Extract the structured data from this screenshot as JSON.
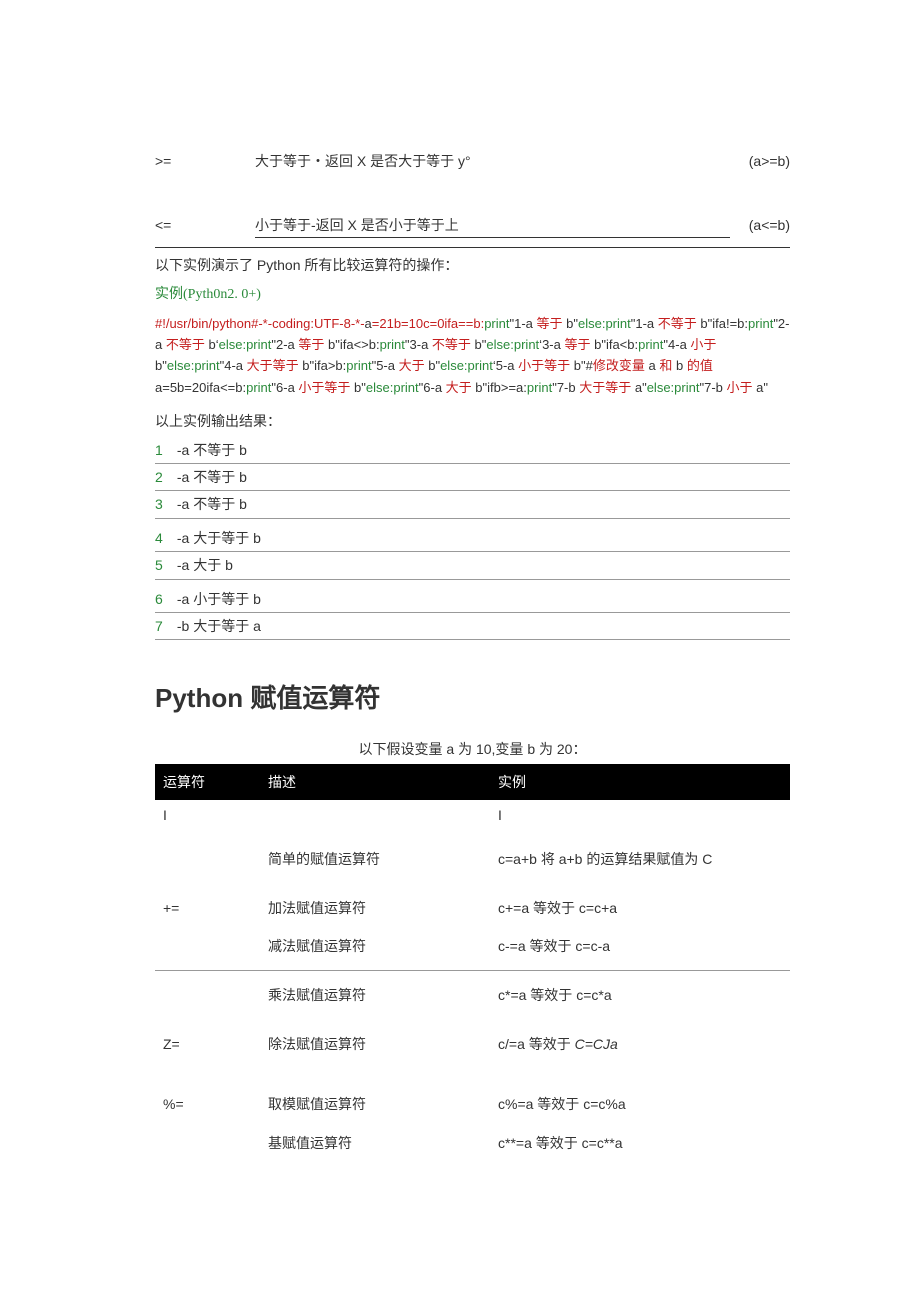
{
  "comparison_rows": [
    {
      "op": ">=",
      "desc": "大于等于・返回 X 是否大于等于 y°",
      "example": "(a>=b)",
      "underlined": false
    },
    {
      "op": "<=",
      "desc": "小于等于-返回 X 是否小于等于上",
      "example": "(a<=b)",
      "underlined": true
    }
  ],
  "intro": "以下实例演示了 Python 所有比较运算符的操作：",
  "example_title": "实例(Pyth0n2. 0+)",
  "code_segments": [
    {
      "t": "#!/usr/bin/python#-*-coding:UTF-8-*-",
      "c": "k-red"
    },
    {
      "t": "a",
      "c": ""
    },
    {
      "t": "=21b=10c=0ifa==b:",
      "c": "k-red"
    },
    {
      "t": "print",
      "c": "k-green"
    },
    {
      "t": "\"1-a ",
      "c": ""
    },
    {
      "t": "等于",
      "c": "k-red"
    },
    {
      "t": " b\"",
      "c": ""
    },
    {
      "t": "else:",
      "c": "k-green"
    },
    {
      "t": "print",
      "c": "k-green"
    },
    {
      "t": "\"1-a ",
      "c": ""
    },
    {
      "t": "不等于",
      "c": "k-red"
    },
    {
      "t": " b\"ifa!=b:",
      "c": ""
    },
    {
      "t": "print",
      "c": "k-green"
    },
    {
      "t": "\"2-a ",
      "c": ""
    },
    {
      "t": "不等于",
      "c": "k-red"
    },
    {
      "t": " b",
      "c": ""
    },
    {
      "t": "‘",
      "c": ""
    },
    {
      "t": "else:",
      "c": "k-green"
    },
    {
      "t": "print",
      "c": "k-green"
    },
    {
      "t": "\"2-a ",
      "c": ""
    },
    {
      "t": "等于",
      "c": "k-red"
    },
    {
      "t": " b\"ifa<>b:",
      "c": ""
    },
    {
      "t": "print",
      "c": "k-green"
    },
    {
      "t": "\"3-a ",
      "c": ""
    },
    {
      "t": "不等于",
      "c": "k-red"
    },
    {
      "t": " b\"",
      "c": ""
    },
    {
      "t": "else:",
      "c": "k-green"
    },
    {
      "t": "print",
      "c": "k-green"
    },
    {
      "t": "‘",
      "c": ""
    },
    {
      "t": "3-a ",
      "c": ""
    },
    {
      "t": "等于",
      "c": "k-red"
    },
    {
      "t": " b\"ifa<b:",
      "c": ""
    },
    {
      "t": "print",
      "c": "k-green"
    },
    {
      "t": "\"4-a ",
      "c": ""
    },
    {
      "t": "小于",
      "c": "k-red"
    },
    {
      "t": " b\"",
      "c": ""
    },
    {
      "t": "else:",
      "c": "k-green"
    },
    {
      "t": "print",
      "c": "k-green"
    },
    {
      "t": "\"4-a ",
      "c": ""
    },
    {
      "t": "大于等于",
      "c": "k-red"
    },
    {
      "t": " b\"ifa>b:",
      "c": ""
    },
    {
      "t": "print",
      "c": "k-green"
    },
    {
      "t": "\"5-a ",
      "c": ""
    },
    {
      "t": "大于",
      "c": "k-red"
    },
    {
      "t": " b\"",
      "c": ""
    },
    {
      "t": "else:",
      "c": "k-green"
    },
    {
      "t": "print",
      "c": "k-green"
    },
    {
      "t": "‘",
      "c": ""
    },
    {
      "t": "5-a ",
      "c": ""
    },
    {
      "t": "小于等于",
      "c": "k-red"
    },
    {
      "t": " b\"#",
      "c": ""
    },
    {
      "t": "修改变量",
      "c": "k-red"
    },
    {
      "t": " a ",
      "c": ""
    },
    {
      "t": "和",
      "c": "k-red"
    },
    {
      "t": " b ",
      "c": ""
    },
    {
      "t": "的值",
      "c": "k-red"
    },
    {
      "t": " a=5b=20ifa<=b:",
      "c": ""
    },
    {
      "t": "print",
      "c": "k-green"
    },
    {
      "t": "\"6-a ",
      "c": ""
    },
    {
      "t": "小于等于",
      "c": "k-red"
    },
    {
      "t": " b\"",
      "c": ""
    },
    {
      "t": "else:",
      "c": "k-green"
    },
    {
      "t": "print",
      "c": "k-green"
    },
    {
      "t": "\"6-a ",
      "c": ""
    },
    {
      "t": "大于",
      "c": "k-red"
    },
    {
      "t": " b\"ifb>=a:",
      "c": ""
    },
    {
      "t": "print",
      "c": "k-green"
    },
    {
      "t": "\"7-b ",
      "c": ""
    },
    {
      "t": "大于等于",
      "c": "k-red"
    },
    {
      "t": " a\"",
      "c": ""
    },
    {
      "t": "else:",
      "c": "k-green"
    },
    {
      "t": "print",
      "c": "k-green"
    },
    {
      "t": "\"7-b ",
      "c": ""
    },
    {
      "t": "小于",
      "c": "k-red"
    },
    {
      "t": " a\"",
      "c": ""
    }
  ],
  "result_intro": "以上实例输出结果：",
  "results": [
    {
      "n": "1",
      "t": "-a 不等于 b"
    },
    {
      "n": "2",
      "t": "-a 不等于 b"
    },
    {
      "n": "3",
      "t": "-a 不等于 b"
    },
    {
      "n": "4",
      "t": "-a 大于等于 b"
    },
    {
      "n": "5",
      "t": "-a 大于 b"
    },
    {
      "n": "6",
      "t": "-a 小于等于 b"
    },
    {
      "n": "7",
      "t": "-b 大于等于 a"
    }
  ],
  "section_title": "Python 赋值运算符",
  "caption": "以下假设变量 a 为 10,变量 b 为 20：",
  "assign_header": {
    "op": "运算符",
    "desc": "描述",
    "ex": "实例"
  },
  "vert_bar": "I",
  "assign_rows": [
    {
      "op": "",
      "desc": "简单的赋值运算符",
      "ex": "c=a+b 将 a+b 的运算结果赋值为 C"
    },
    {
      "op": "+=",
      "desc": "加法赋值运算符",
      "ex": "c+=a 等效于 c=c+a"
    },
    {
      "op": "",
      "desc": "减法赋值运算符",
      "ex": "c-=a 等效于 c=c-a"
    },
    {
      "op": "",
      "desc": "乘法赋值运算符",
      "ex": "c*=a 等效于 c=c*a"
    },
    {
      "op": "Z=",
      "desc": "除法赋值运算符",
      "ex_prefix": "c/=a 等效于 ",
      "ex_italic": "C=CJa"
    },
    {
      "op": "%=",
      "desc": "取模赋值运算符",
      "ex": "c%=a 等效于 c=c%a"
    },
    {
      "op": "",
      "desc": "基赋值运算符",
      "ex": "c**=a 等效于 c=c**a"
    }
  ]
}
